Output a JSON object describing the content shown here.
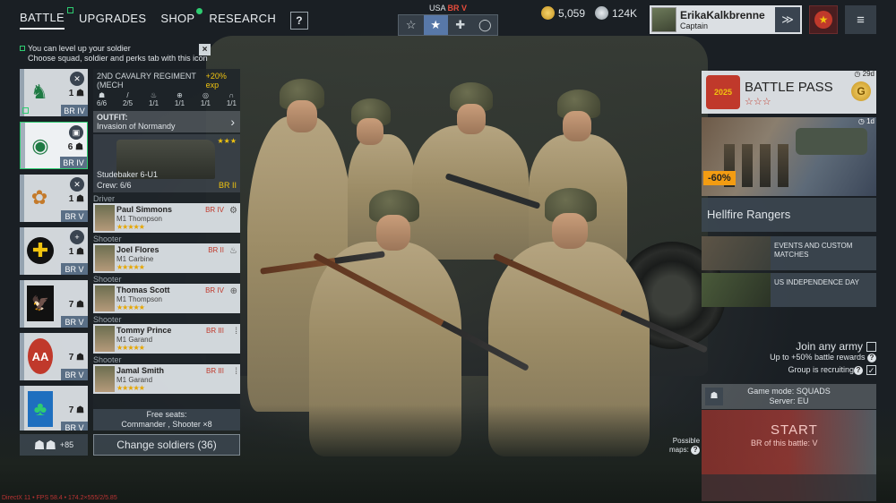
{
  "nav": {
    "tabs": [
      "BATTLE",
      "UPGRADES",
      "SHOP",
      "RESEARCH"
    ],
    "help_label": "?"
  },
  "notice": {
    "line1": "You can level up your soldier",
    "line2": "Choose squad, soldier and perks tab with this icon",
    "close": "×"
  },
  "br_selector": {
    "nation": "USA",
    "br": "BR V",
    "icons": [
      "☆",
      "★",
      "✚",
      "◯"
    ]
  },
  "currency": {
    "gold": "5,059",
    "silver": "124K"
  },
  "profile": {
    "name": "ErikaKalkbrenne",
    "rank": "Captain",
    "rank_icon": "≫",
    "menu_icon": "≡"
  },
  "squads": [
    {
      "emblem": "♞",
      "count": "1",
      "br": "BR IV"
    },
    {
      "emblem": "◉",
      "count": "6",
      "br": "BR IV"
    },
    {
      "emblem": "✿",
      "count": "1",
      "br": "BR V"
    },
    {
      "emblem": "✚",
      "count": "1",
      "br": "BR V"
    },
    {
      "emblem": "🦅",
      "count": "7",
      "br": "BR V"
    },
    {
      "emblem": "AA",
      "count": "7",
      "br": "BR V"
    },
    {
      "emblem": "♣",
      "count": "7",
      "br": "BR V"
    }
  ],
  "squad_bottom": {
    "count": "+85"
  },
  "detail": {
    "regiment": "2ND CAVALRY REGIMENT (MECH",
    "exp": "+20% exp",
    "stats": [
      "6/6",
      "2/5",
      "1/1",
      "1/1",
      "1/1",
      "1/1"
    ],
    "outfit_label": "OUTFIT:",
    "outfit_value": "Invasion of Normandy",
    "vehicle_name": "Studebaker 6-U1",
    "vehicle_crew": "Crew: 6/6",
    "vehicle_br": "BR II",
    "vehicle_stars": "★★★"
  },
  "soldiers": [
    {
      "role": "Driver",
      "name": "Paul Simmons",
      "weapon": "M1 Thompson",
      "br": "BR IV",
      "stars": "★★★★★"
    },
    {
      "role": "Shooter",
      "name": "Joel Flores",
      "weapon": "M1 Carbine",
      "br": "BR II",
      "stars": "★★★★★"
    },
    {
      "role": "Shooter",
      "name": "Thomas Scott",
      "weapon": "M1 Thompson",
      "br": "BR IV",
      "stars": "★★★★★"
    },
    {
      "role": "Shooter",
      "name": "Tommy Prince",
      "weapon": "M1 Garand",
      "br": "BR III",
      "stars": "★★★★★"
    },
    {
      "role": "Shooter",
      "name": "Jamal Smith",
      "weapon": "M1 Garand",
      "br": "BR III",
      "stars": "★★★★★"
    }
  ],
  "free_seats": {
    "line1": "Free seats:",
    "line2": "Commander , Shooter ×8"
  },
  "change_soldiers": "Change soldiers (36)",
  "battle_pass": {
    "title": "BATTLE PASS",
    "stars": "☆☆☆",
    "days": "29d",
    "year": "2025",
    "gold": "G"
  },
  "offer": {
    "discount": "-60%",
    "days": "1d"
  },
  "hellfire": "Hellfire Rangers",
  "events": [
    {
      "line1": "EVENTS AND CUSTOM",
      "line2": "MATCHES"
    },
    {
      "line1": "US INDEPENDENCE DAY",
      "line2": ""
    }
  ],
  "join": {
    "title": "Join any army",
    "sub": "Up to +50% battle rewards",
    "recruit": "Group is recruiting",
    "check": "✓"
  },
  "game_mode": {
    "line1": "Game mode: SQUADS",
    "line2": "Server: EU"
  },
  "start": {
    "label": "START",
    "br": "BR of this battle: V"
  },
  "possible_maps": {
    "line1": "Possible",
    "line2": "maps:"
  },
  "debug": "DirectX 11 • FPS 58.4 • 174.2×555/2/5.85"
}
